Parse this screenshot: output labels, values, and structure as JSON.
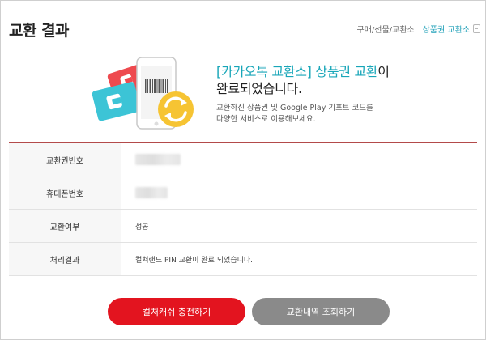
{
  "header": {
    "title": "교환 결과",
    "breadcrumb": "구매/선물/교환소",
    "breadcrumb_current": "상품권 교환소"
  },
  "result": {
    "title_highlight": "[카카오톡 교환소] 상품권 교환",
    "title_suffix": "이",
    "title_line2": "완료되었습니다.",
    "desc_line1": "교환하신 상품권 및 Google Play 기프트 코드를",
    "desc_line2": "다양한 서비스로 이용해보세요."
  },
  "table": {
    "rows": [
      {
        "label": "교환권번호",
        "value": ""
      },
      {
        "label": "휴대폰번호",
        "value": ""
      },
      {
        "label": "교환여부",
        "value": "성공"
      },
      {
        "label": "처리결과",
        "value": "컬쳐랜드 PIN 교환이 완료 되었습니다."
      }
    ]
  },
  "buttons": {
    "charge": "컬처캐쉬 충전하기",
    "history": "교환내역 조회하기"
  },
  "colors": {
    "accent": "#18a6b8",
    "table_top_border": "#b34a4a",
    "primary_button": "#e3141f",
    "secondary_button": "#8a8a8a",
    "coin": "#f6c433"
  },
  "icons": [
    "gift-card-icon",
    "mobile-phone-icon",
    "barcode-icon",
    "refresh-coin-icon",
    "external-link-icon"
  ]
}
